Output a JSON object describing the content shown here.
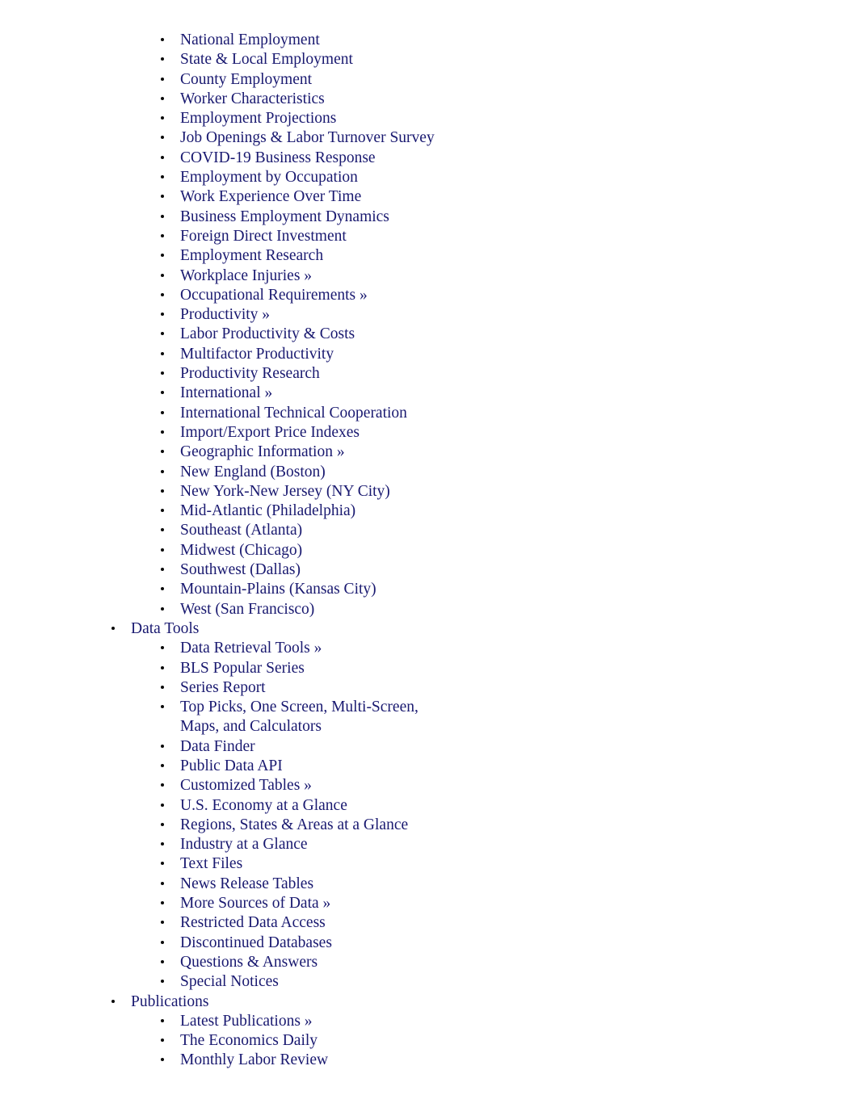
{
  "document": {
    "text_color": "#191970",
    "bullet_color": "#0a0a0a",
    "background_color": "#ffffff"
  },
  "outline": {
    "nodes": [
      {
        "level": 2,
        "label": "National Employment"
      },
      {
        "level": 2,
        "label": "State & Local Employment"
      },
      {
        "level": 2,
        "label": "County Employment"
      },
      {
        "level": 2,
        "label": "Worker Characteristics"
      },
      {
        "level": 2,
        "label": "Employment Projections"
      },
      {
        "level": 2,
        "label": "Job Openings & Labor Turnover Survey"
      },
      {
        "level": 2,
        "label": "COVID-19 Business Response"
      },
      {
        "level": 2,
        "label": "Employment by Occupation"
      },
      {
        "level": 2,
        "label": "Work Experience Over Time"
      },
      {
        "level": 2,
        "label": "Business Employment Dynamics"
      },
      {
        "level": 2,
        "label": "Foreign Direct Investment"
      },
      {
        "level": 2,
        "label": "Employment Research"
      },
      {
        "level": 2,
        "label": "Workplace Injuries »"
      },
      {
        "level": 2,
        "label": "Occupational Requirements »"
      },
      {
        "level": 2,
        "label": "Productivity »"
      },
      {
        "level": 2,
        "label": "Labor Productivity & Costs"
      },
      {
        "level": 2,
        "label": "Multifactor Productivity"
      },
      {
        "level": 2,
        "label": "Productivity Research"
      },
      {
        "level": 2,
        "label": "International »"
      },
      {
        "level": 2,
        "label": "International Technical Cooperation"
      },
      {
        "level": 2,
        "label": "Import/Export Price Indexes"
      },
      {
        "level": 2,
        "label": "Geographic Information »"
      },
      {
        "level": 2,
        "label": "New England (Boston)"
      },
      {
        "level": 2,
        "label": "New York-New Jersey (NY City)"
      },
      {
        "level": 2,
        "label": "Mid-Atlantic (Philadelphia)"
      },
      {
        "level": 2,
        "label": "Southeast (Atlanta)"
      },
      {
        "level": 2,
        "label": "Midwest (Chicago)"
      },
      {
        "level": 2,
        "label": "Southwest (Dallas)"
      },
      {
        "level": 2,
        "label": "Mountain-Plains (Kansas City)"
      },
      {
        "level": 2,
        "label": "West (San Francisco)"
      },
      {
        "level": 1,
        "label": "Data Tools"
      },
      {
        "level": 2,
        "label": "Data Retrieval Tools »"
      },
      {
        "level": 2,
        "label": "BLS Popular Series"
      },
      {
        "level": 2,
        "label": "Series Report"
      },
      {
        "level": 2,
        "label": "Top Picks, One Screen, Multi-Screen, Maps, and Calculators"
      },
      {
        "level": 2,
        "label": "Data Finder"
      },
      {
        "level": 2,
        "label": "Public Data API"
      },
      {
        "level": 2,
        "label": "Customized Tables »"
      },
      {
        "level": 2,
        "label": "U.S. Economy at a Glance"
      },
      {
        "level": 2,
        "label": "Regions, States & Areas at a Glance"
      },
      {
        "level": 2,
        "label": "Industry at a Glance"
      },
      {
        "level": 2,
        "label": "Text Files"
      },
      {
        "level": 2,
        "label": "News Release Tables"
      },
      {
        "level": 2,
        "label": "More Sources of Data »"
      },
      {
        "level": 2,
        "label": "Restricted Data Access"
      },
      {
        "level": 2,
        "label": "Discontinued Databases"
      },
      {
        "level": 2,
        "label": "Questions & Answers"
      },
      {
        "level": 2,
        "label": "Special Notices"
      },
      {
        "level": 1,
        "label": "Publications"
      },
      {
        "level": 2,
        "label": "Latest Publications »"
      },
      {
        "level": 2,
        "label": "The Economics Daily"
      },
      {
        "level": 2,
        "label": "Monthly Labor Review"
      }
    ]
  }
}
